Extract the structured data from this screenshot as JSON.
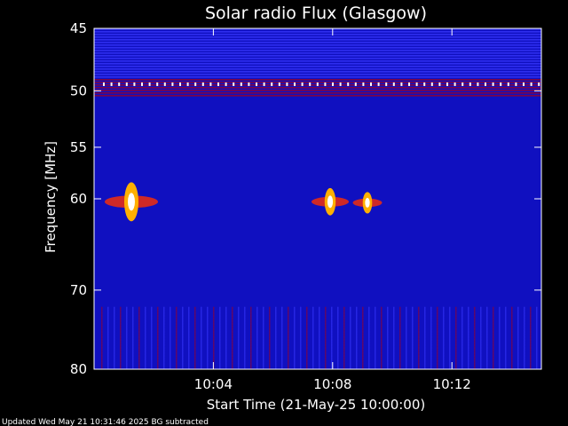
{
  "chart_data": {
    "type": "heatmap",
    "title": "Solar radio Flux (Glasgow)",
    "xlabel": "Start Time (21-May-25 10:00:00)",
    "ylabel": "Frequency [MHz]",
    "x_ticks": [
      "10:04",
      "10:08",
      "10:12"
    ],
    "y_ticks": [
      45,
      50,
      55,
      60,
      70,
      80
    ],
    "xlim": [
      "10:00:00",
      "10:15:00"
    ],
    "ylim": [
      45,
      80
    ],
    "y_scale": "log",
    "grid": false,
    "colorscale": [
      "#000060",
      "#1010c0",
      "#3838ff",
      "#a00020",
      "#ff3000",
      "#ffb000",
      "#ffffff"
    ],
    "background_level": 0.25,
    "bursts": [
      {
        "time": "10:01:15",
        "freq": 60.3,
        "intensity": 1.0
      },
      {
        "time": "10:07:55",
        "freq": 60.3,
        "intensity": 0.7
      },
      {
        "time": "10:09:10",
        "freq": 60.4,
        "intensity": 0.55
      }
    ],
    "footer": "Updated Wed May 21 10:31:46 2025   BG subtracted"
  }
}
